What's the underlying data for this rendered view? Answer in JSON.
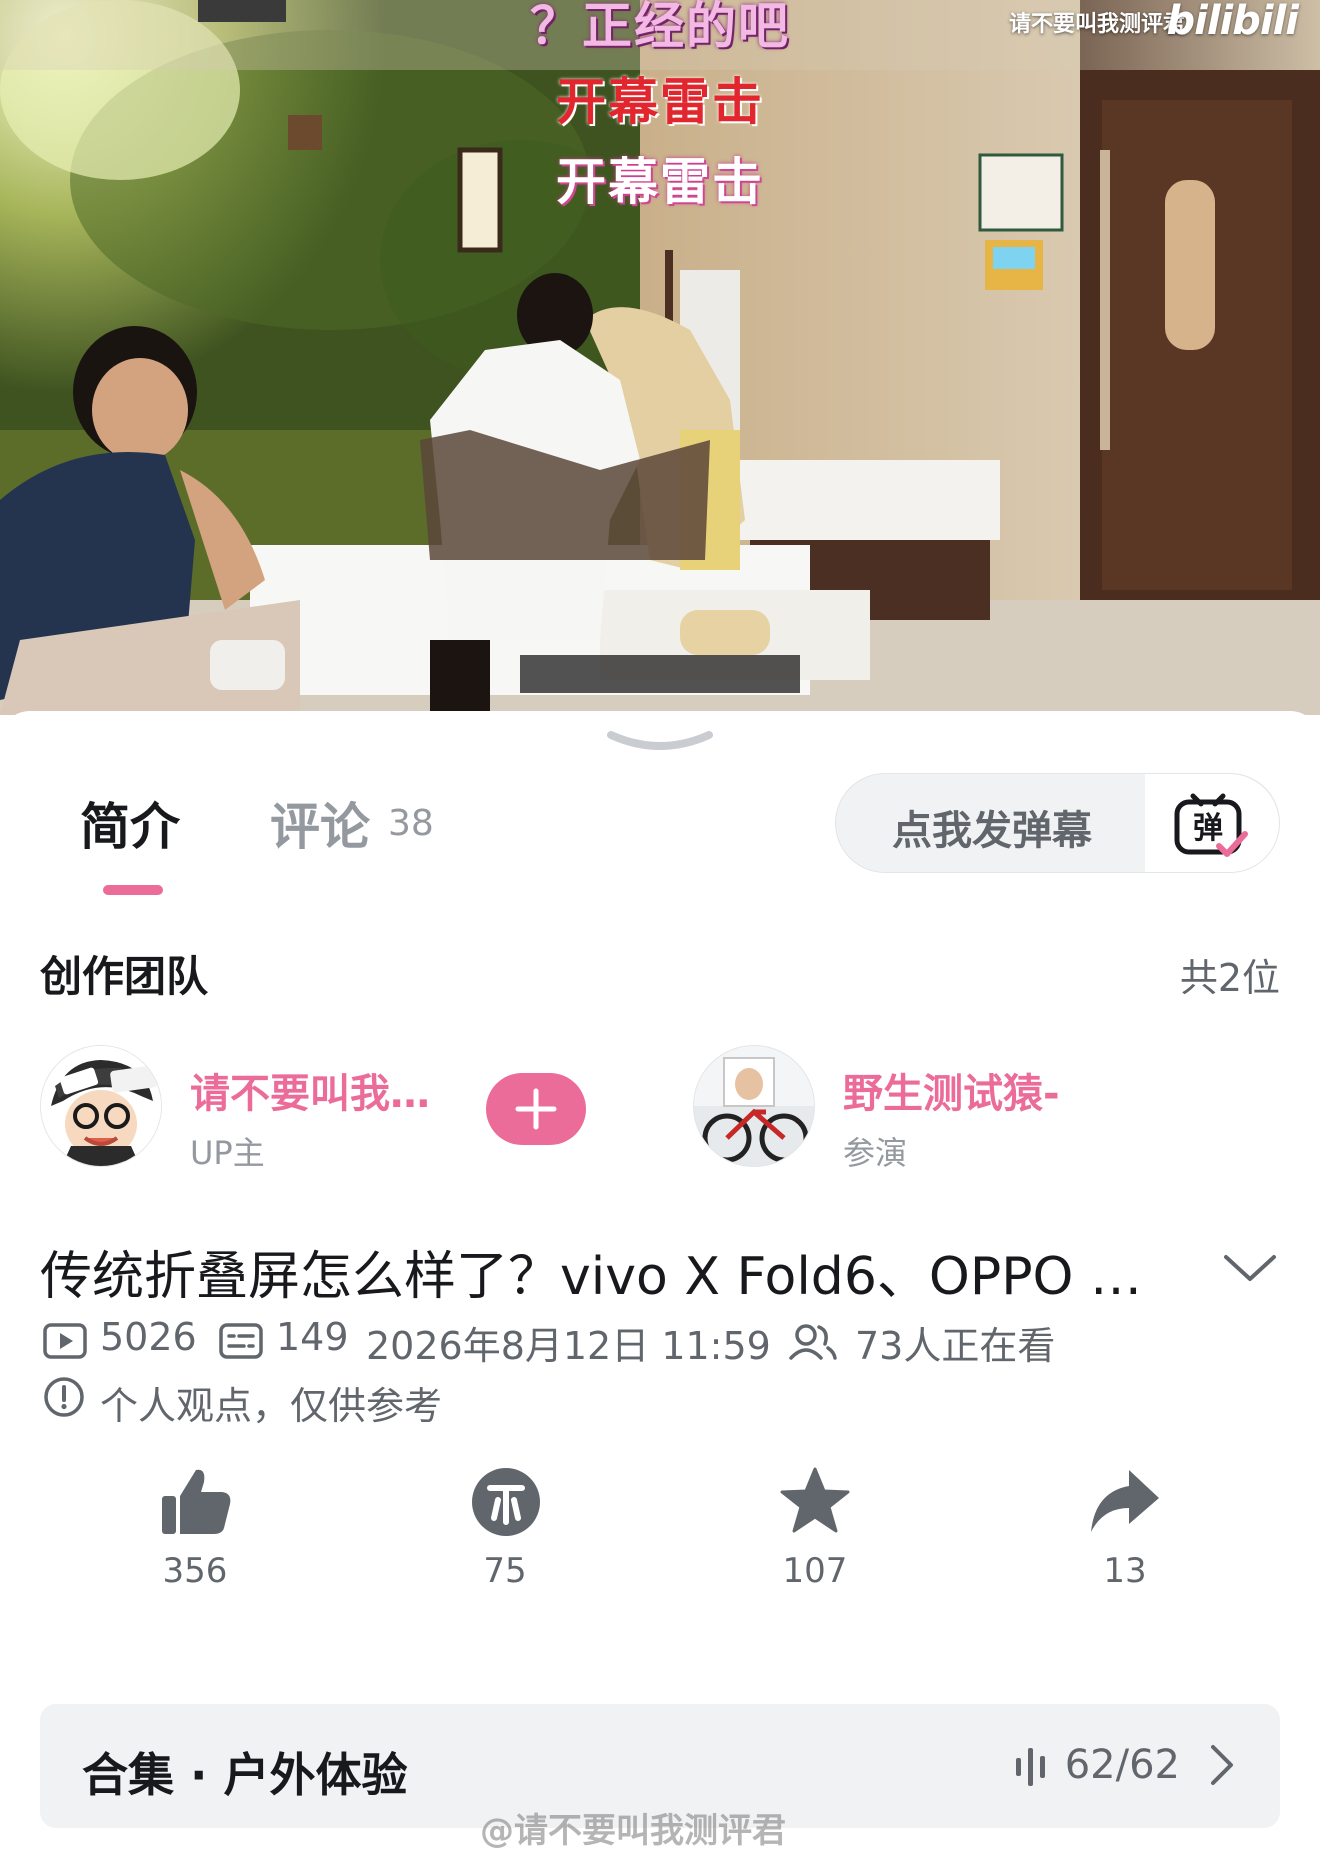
{
  "video": {
    "danmaku": [
      "？正经的吧",
      "开幕雷击",
      "开幕雷击"
    ],
    "channel_watermark": "请不要叫我测评君",
    "platform_logo": "bilibili"
  },
  "tabs": [
    {
      "label": "简介"
    },
    {
      "label": "评论",
      "count": "38"
    }
  ],
  "danmaku_input": {
    "placeholder": "点我发弹幕",
    "toggle_label": "弹"
  },
  "team": {
    "title": "创作团队",
    "count": "共2位",
    "members": [
      {
        "name": "请不要叫我…",
        "role": "UP主"
      },
      {
        "name": "野生测试猿-",
        "role": "参演"
      }
    ]
  },
  "video_info": {
    "title": "传统折叠屏怎么样了？vivo X Fold6、OPPO …",
    "plays": "5026",
    "danmaku_count": "149",
    "publish_time": "2026年8月12日 11:59",
    "watching": "73人正在看",
    "notice": "个人观点，仅供参考"
  },
  "actions": [
    {
      "name": "like",
      "count": "356"
    },
    {
      "name": "coin",
      "count": "75"
    },
    {
      "name": "favorite",
      "count": "107"
    },
    {
      "name": "share",
      "count": "13"
    }
  ],
  "collection": {
    "title": "合集 · 户外体验",
    "progress": "62/62"
  },
  "footer_watermark": "@请不要叫我测评君",
  "colors": {
    "accent": "#ec6c99",
    "text_primary": "#18191c",
    "text_secondary": "#61666d",
    "text_tertiary": "#9499a0",
    "surface": "#f1f2f3"
  }
}
